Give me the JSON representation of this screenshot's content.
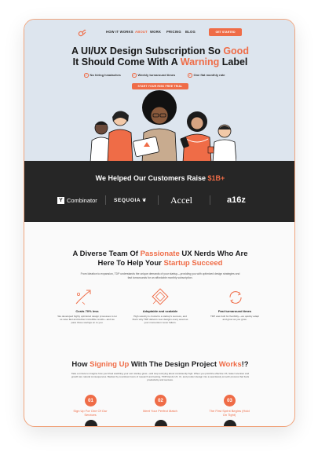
{
  "nav": {
    "links": [
      "HOW IT WORKS",
      "ABOUT",
      "WORK",
      "PRICING",
      "BLOG"
    ],
    "active": "ABOUT",
    "cta": "GET STARTED"
  },
  "hero": {
    "title_line1_a": "A UI/UX Design Subscription So ",
    "title_line1_b": "Good",
    "title_line2_a": "It Should Come With A ",
    "title_line2_b": "Warning",
    "title_line2_c": " Label",
    "features": [
      "No hiring headaches",
      "Weekly turnaround times",
      "One flat monthly rate"
    ],
    "cta": "START YOUR RISK FREE TRIAL"
  },
  "raise": {
    "heading_a": "We Helped Our Customers Raise ",
    "heading_b": "$1B+",
    "brands": [
      "Combinator",
      "SEQUOIA",
      "Accel",
      "a16z"
    ]
  },
  "team": {
    "h_line1_a": "A Diverse Team Of ",
    "h_line1_b": "Passionate",
    "h_line1_c": " UX Nerds Who Are",
    "h_line2_a": "Here To Help Your ",
    "h_line2_b": "Startup Succeed",
    "para": "From Ideation to expansion, TDP understands the unique demands of your startup—providing you with optimized design strategies and fast turnarounds for an affordable monthly subscription.",
    "columns": [
      {
        "title": "Costs 70% less",
        "text": "We developed highly optimized design processes to let us save fast and deliver incredible results—and we pass those savings on to you."
      },
      {
        "title": "Adaptable and scalable",
        "text": "High velocity is crucial to a startup's success, and that's why TDP delivers new designs every week as your momentum never falters."
      },
      {
        "title": "Fast turnaround times",
        "text": "TDP was built for flexibility—we quickly adapt and grow as you grow."
      }
    ]
  },
  "process": {
    "h_a": "How ",
    "h_b": "Signing Up",
    "h_c": " With The Design Project ",
    "h_d": "Works",
    "h_e": "!?",
    "para": "Take a minute to imagine how you'd feel watching your own startup grow—and stop worrying about consistently high. When you prioritize effective UX, faster retention and growth are natural consequences. Backed by countless hours of research and testing, TDP blends UX, UI, and product design into a seamlessly smooth process that fuels productivity and success.",
    "steps": [
      {
        "num": "01",
        "label": "Sign Up For One Of Our Services"
      },
      {
        "num": "02",
        "label": "Meet Your Perfect Match"
      },
      {
        "num": "03",
        "label": "The First Sprint Begins (Hold On Tight)"
      }
    ]
  },
  "colors": {
    "accent": "#ef6c47",
    "hero_bg": "#dde5ee",
    "dark_bg": "#262626"
  }
}
